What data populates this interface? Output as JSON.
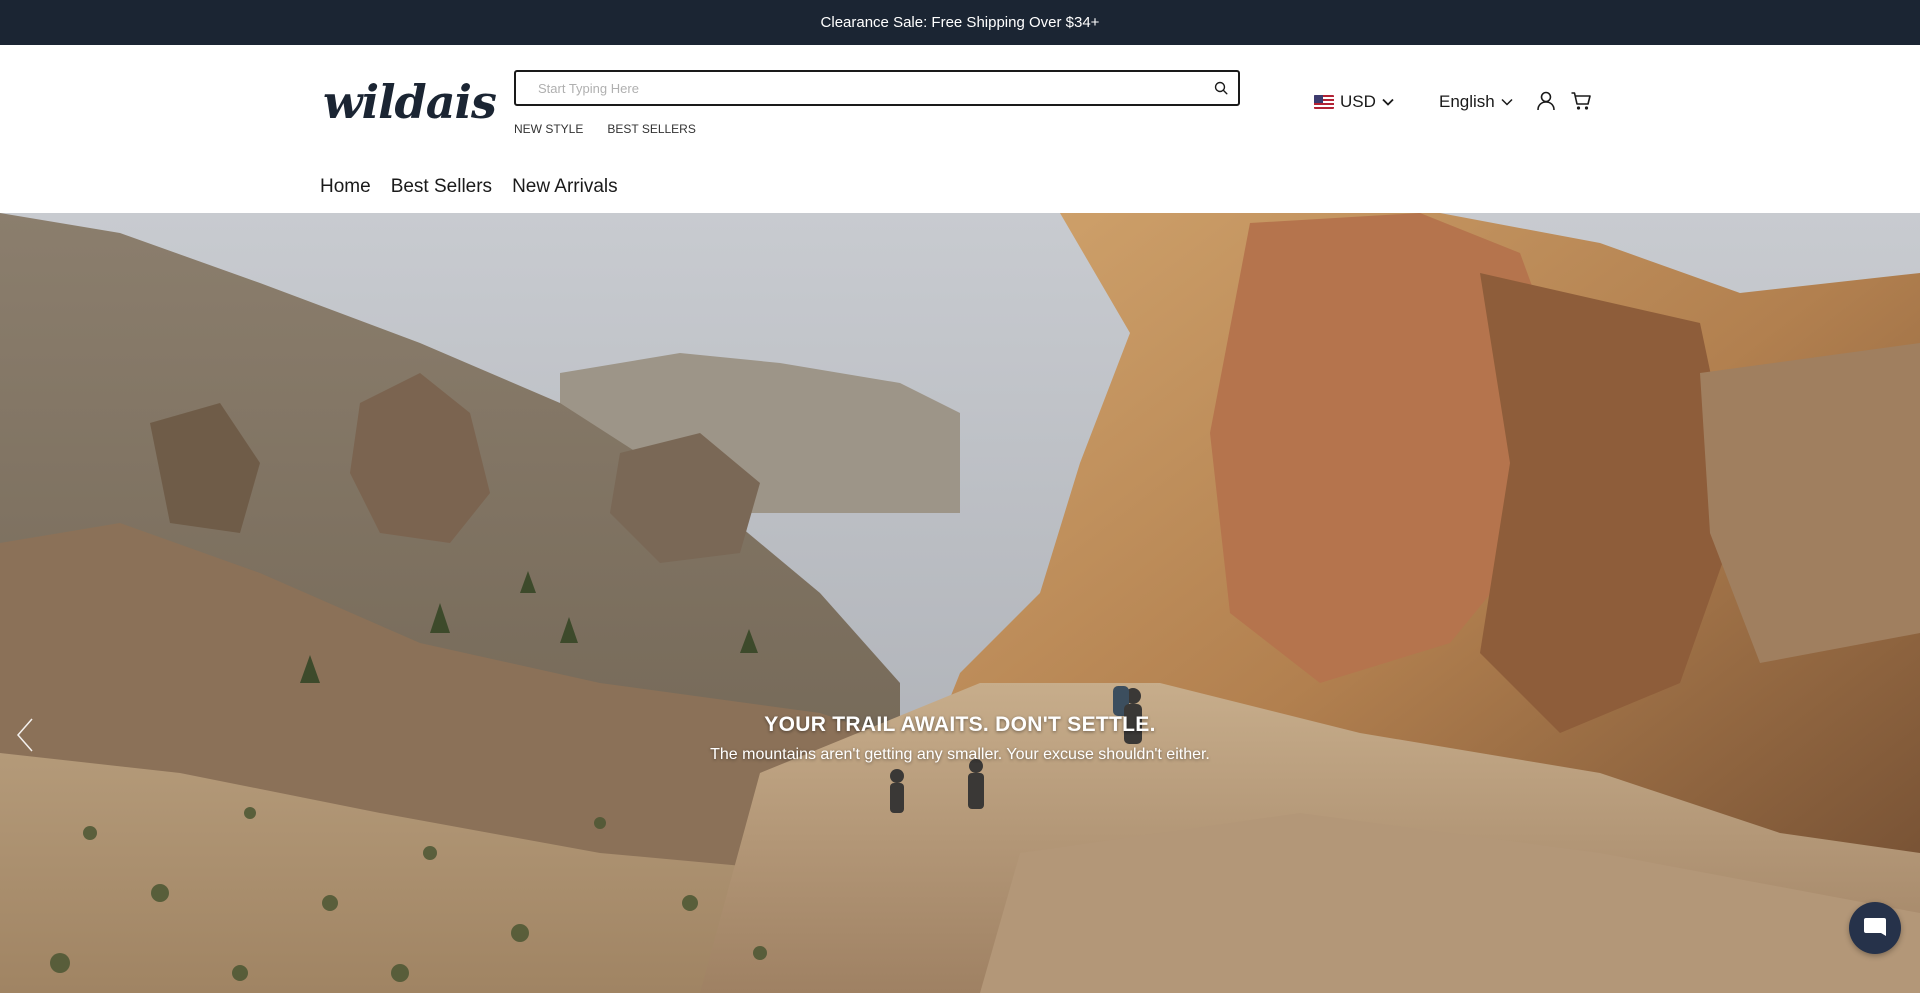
{
  "announcement": {
    "text": "Clearance Sale: Free Shipping Over $34+"
  },
  "header": {
    "logo": "wildais",
    "search": {
      "placeholder": "Start Typing Here",
      "value": ""
    },
    "quick_links": [
      "NEW STYLE",
      "BEST SELLERS"
    ],
    "currency": {
      "label": "USD",
      "flag": "us-flag-icon"
    },
    "language": {
      "label": "English"
    },
    "icons": [
      "account-icon",
      "cart-icon",
      "search-icon",
      "chevron-down-icon"
    ]
  },
  "nav": {
    "items": [
      "Home",
      "Best Sellers",
      "New Arrivals"
    ]
  },
  "hero": {
    "title": "YOUR TRAIL AWAITS. DON'T SETTLE.",
    "subtitle": "The mountains aren't getting any smaller. Your excuse shouldn't either."
  },
  "chat": {
    "icon": "chat-bubble-icon"
  },
  "colors": {
    "announcement_bg": "#1b2533",
    "chat_bg": "#26324a",
    "text": "#1a1a1a"
  }
}
